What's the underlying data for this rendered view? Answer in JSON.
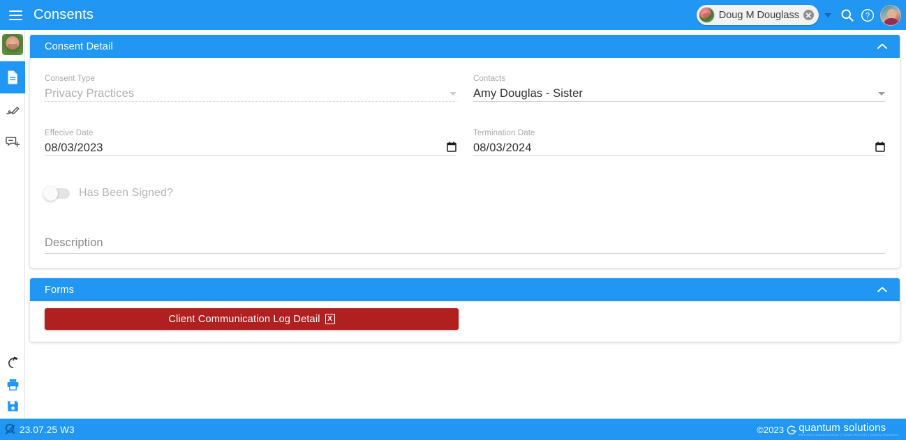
{
  "topbar": {
    "menu_icon": "hamburger-menu-icon",
    "title": "Consents",
    "user_chip": {
      "name": "Doug M Douglass",
      "avatar_icon": "client-avatar",
      "close_icon": "remove-client-icon"
    },
    "dropdown_icon": "chevron-down-icon",
    "search_icon": "search-icon",
    "help_icon": "help-circle-icon",
    "profile_icon": "user-profile-avatar"
  },
  "rail": {
    "avatar_icon": "client-photo-avatar",
    "items": [
      {
        "name": "sidebar-item-documents",
        "icon": "document-icon",
        "active": true
      },
      {
        "name": "sidebar-item-signature",
        "icon": "pen-signature-icon",
        "active": false
      },
      {
        "name": "sidebar-item-add-note",
        "icon": "comment-add-icon",
        "active": false
      }
    ],
    "bottom_items": [
      {
        "name": "sidebar-item-undo",
        "icon": "undo-arrow-icon"
      },
      {
        "name": "sidebar-item-print",
        "icon": "printer-icon"
      },
      {
        "name": "sidebar-item-save",
        "icon": "save-floppy-icon"
      }
    ]
  },
  "consent_detail": {
    "title": "Consent Detail",
    "collapse_icon": "chevron-up-icon",
    "consent_type": {
      "label": "Consent Type",
      "value": "Privacy Practices"
    },
    "contacts": {
      "label": "Contacts",
      "value": "Amy Douglas - Sister"
    },
    "effective_date": {
      "label": "Effecive Date",
      "value": "08/03/2023",
      "icon": "calendar-icon"
    },
    "termination_date": {
      "label": "Termination Date",
      "value": "08/03/2024",
      "icon": "calendar-icon"
    },
    "has_been_signed": {
      "label": "Has Been Signed?",
      "value": "off"
    },
    "description": {
      "placeholder": "Description",
      "value": ""
    }
  },
  "forms": {
    "title": "Forms",
    "collapse_icon": "chevron-up-icon",
    "buttons": [
      {
        "label": "Client Communication Log Detail",
        "badge": "X",
        "color": "#b02020"
      }
    ]
  },
  "footer": {
    "logo_icon": "quantum-q-icon",
    "version": "23.07.25 W3",
    "copyright": "©2023",
    "brand_icon": "quantum-swirl-icon",
    "brand_name": "quantum solutions",
    "brand_tagline": "Electronic Documentation  |  Health Records  |  Quality Assurance"
  },
  "colors": {
    "primary": "#2196f3",
    "danger": "#b02020",
    "page_bg": "#ffffff",
    "label": "#a9a9a9",
    "value": "#303030"
  }
}
